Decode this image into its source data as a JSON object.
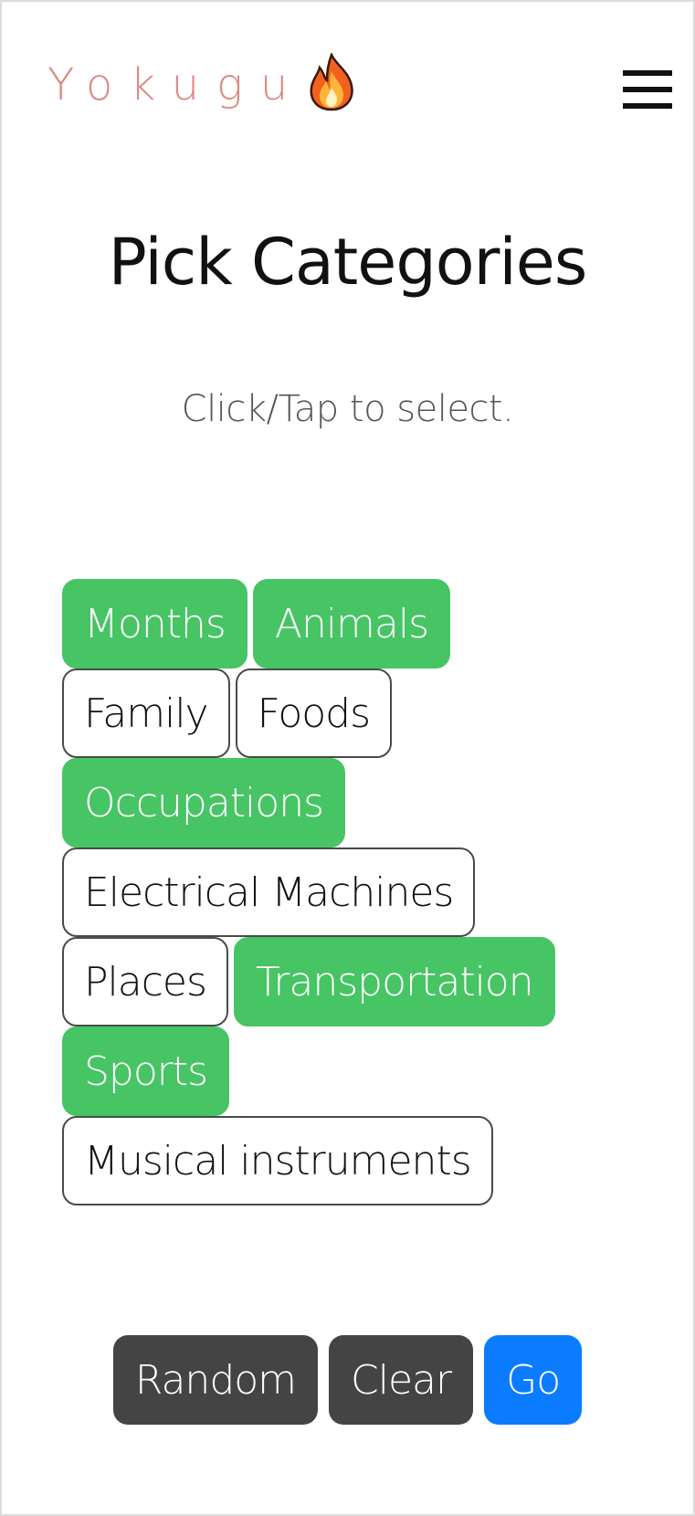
{
  "header": {
    "logo_text": "Yokugu",
    "logo_icon": "fire-icon",
    "menu_icon": "hamburger-menu-icon"
  },
  "page": {
    "title": "Pick Categories",
    "subtitle": "Click/Tap to select."
  },
  "categories": {
    "items": [
      {
        "label": "Months",
        "selected": true
      },
      {
        "label": "Animals",
        "selected": true
      },
      {
        "label": "Family",
        "selected": false
      },
      {
        "label": "Foods",
        "selected": false
      },
      {
        "label": "Occupations",
        "selected": true
      },
      {
        "label": "Electrical Machines",
        "selected": false
      },
      {
        "label": "Places",
        "selected": false
      },
      {
        "label": "Transportation",
        "selected": true
      },
      {
        "label": "Sports",
        "selected": true
      },
      {
        "label": "Musical instruments",
        "selected": false
      }
    ]
  },
  "actions": {
    "random_label": "Random",
    "clear_label": "Clear",
    "go_label": "Go"
  },
  "colors": {
    "logo_text": "#dc8a82",
    "selected_pill": "#47c464",
    "dark_button": "#444444",
    "primary_button": "#0b7cff"
  }
}
